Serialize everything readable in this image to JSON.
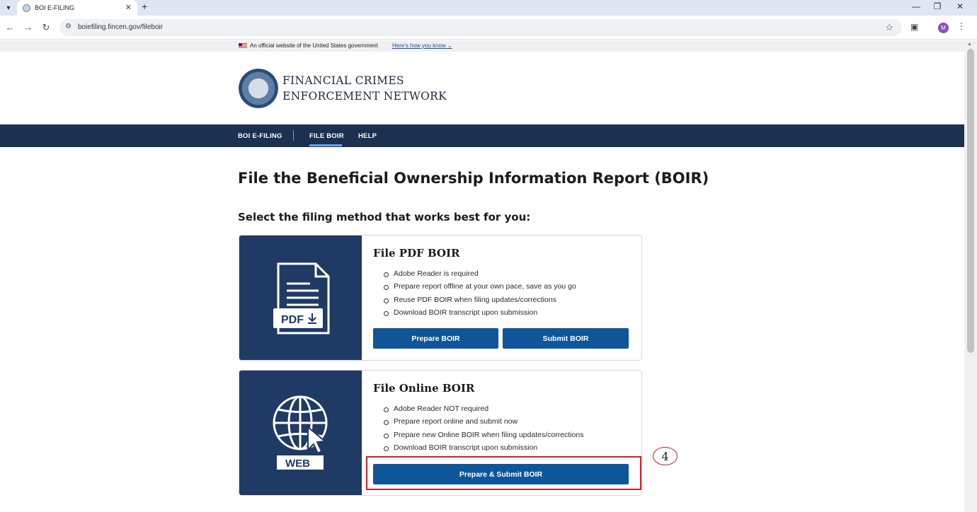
{
  "browser": {
    "tab_title": "BOI E-FILING",
    "url": "boiefiling.fincen.gov/fileboir",
    "avatar_letter": "M"
  },
  "gov_banner": {
    "text": "An official website of the United States government",
    "link": "Here's how you know"
  },
  "agency": {
    "line1": "FINANCIAL CRIMES",
    "line2": "ENFORCEMENT NETWORK"
  },
  "nav": {
    "items": [
      "BOI E-FILING",
      "FILE BOIR",
      "HELP"
    ],
    "active": "FILE BOIR"
  },
  "main": {
    "title": "File the Beneficial Ownership Information Report (BOIR)",
    "subheading": "Select the filing method that works best for you:"
  },
  "cards": [
    {
      "icon_label": "PDF",
      "title": "File PDF BOIR",
      "bullets": [
        "Adobe Reader is required",
        "Prepare report offline at your own pace, save as you go",
        "Reuse PDF BOIR when filing updates/corrections",
        "Download BOIR transcript upon submission"
      ],
      "buttons": [
        "Prepare BOIR",
        "Submit BOIR"
      ]
    },
    {
      "icon_label": "WEB",
      "title": "File Online BOIR",
      "bullets": [
        "Adobe Reader NOT required",
        "Prepare report online and submit now",
        "Prepare new Online BOIR when filing updates/corrections",
        "Download BOIR transcript upon submission"
      ],
      "buttons": [
        "Prepare & Submit BOIR"
      ]
    }
  ],
  "annotation": {
    "step": "4",
    "highlight_color": "#d0202a"
  },
  "colors": {
    "navbar": "#1c3052",
    "icon_panel": "#1f3a64",
    "button": "#0e5699"
  }
}
